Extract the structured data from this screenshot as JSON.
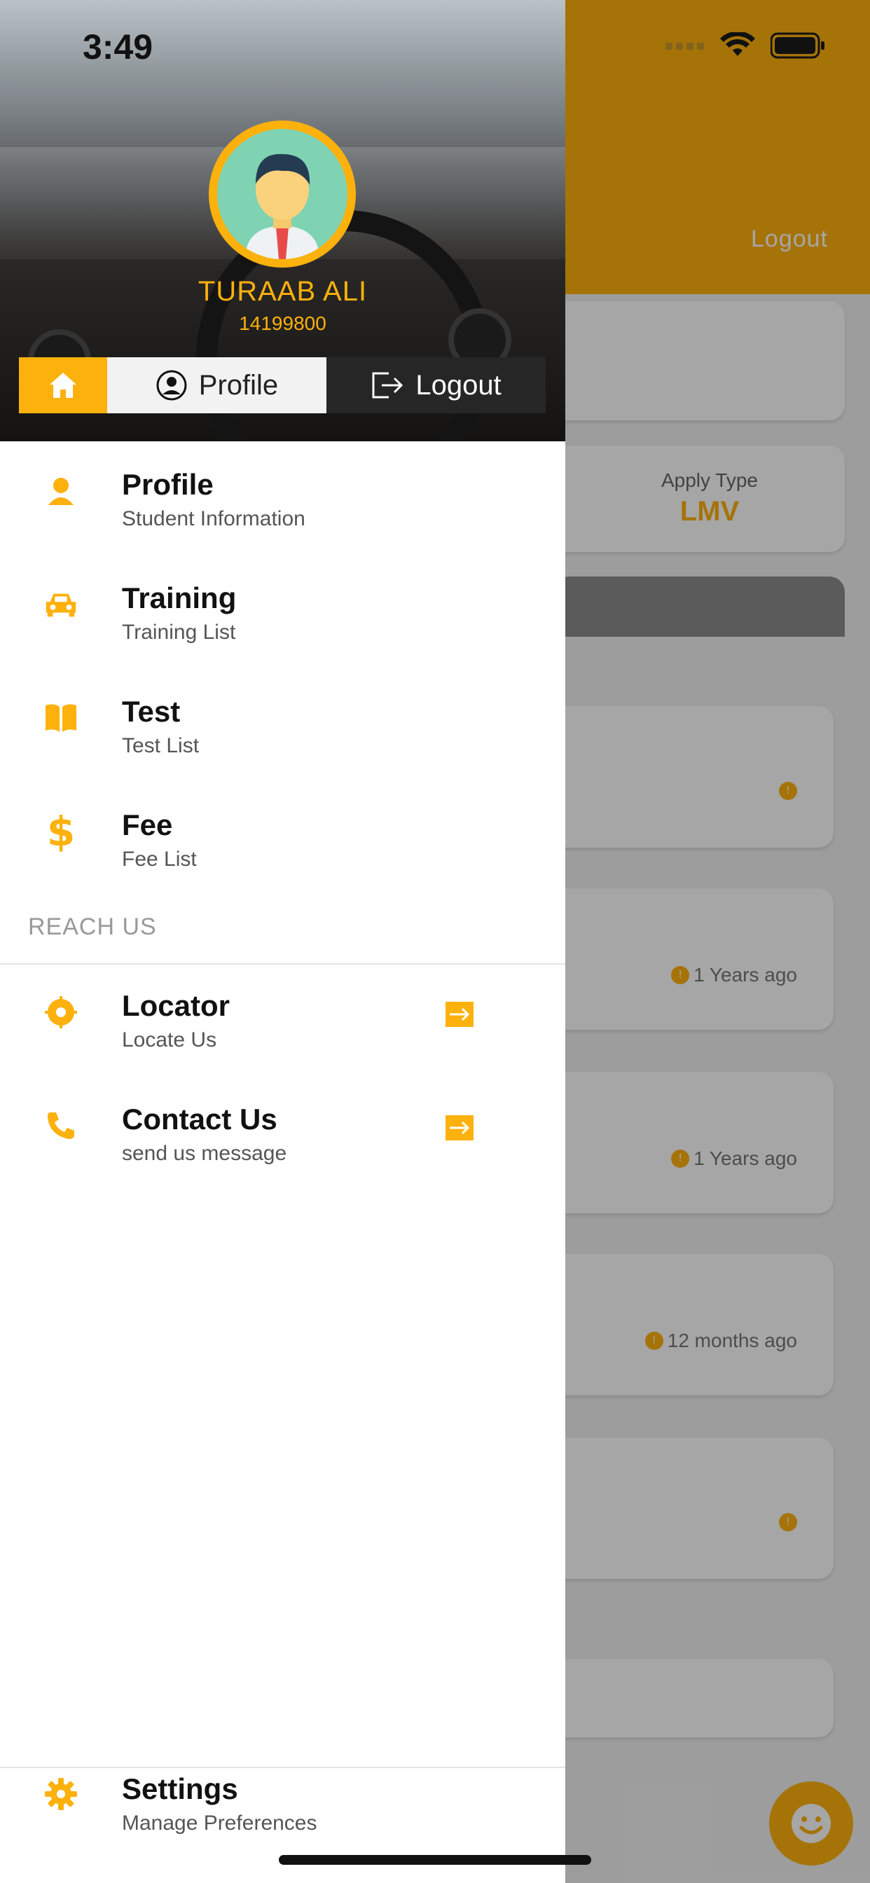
{
  "status_bar": {
    "time": "3:49"
  },
  "background": {
    "logout_label": "Logout",
    "apply_type_label": "Apply Type",
    "apply_type_value": "LMV",
    "time_labels": [
      "1 Years ago",
      "1 Years ago",
      "12 months ago"
    ]
  },
  "drawer": {
    "user": {
      "name": "TURAAB ALI",
      "id": "14199800"
    },
    "tabs": {
      "profile_label": "Profile",
      "logout_label": "Logout"
    },
    "menu": [
      {
        "title": "Profile",
        "subtitle": "Student Information",
        "icon": "person-icon"
      },
      {
        "title": "Training",
        "subtitle": "Training List",
        "icon": "car-icon"
      },
      {
        "title": "Test",
        "subtitle": "Test List",
        "icon": "book-icon"
      },
      {
        "title": "Fee",
        "subtitle": "Fee List",
        "icon": "dollar-icon"
      }
    ],
    "section_label": "REACH US",
    "reach_us": [
      {
        "title": "Locator",
        "subtitle": "Locate Us",
        "icon": "locator-icon"
      },
      {
        "title": "Contact Us",
        "subtitle": "send us message",
        "icon": "phone-icon"
      }
    ],
    "settings": {
      "title": "Settings",
      "subtitle": "Manage Preferences",
      "icon": "gear-icon"
    }
  },
  "colors": {
    "accent": "#FDB10D",
    "dark_tab": "#262626"
  }
}
